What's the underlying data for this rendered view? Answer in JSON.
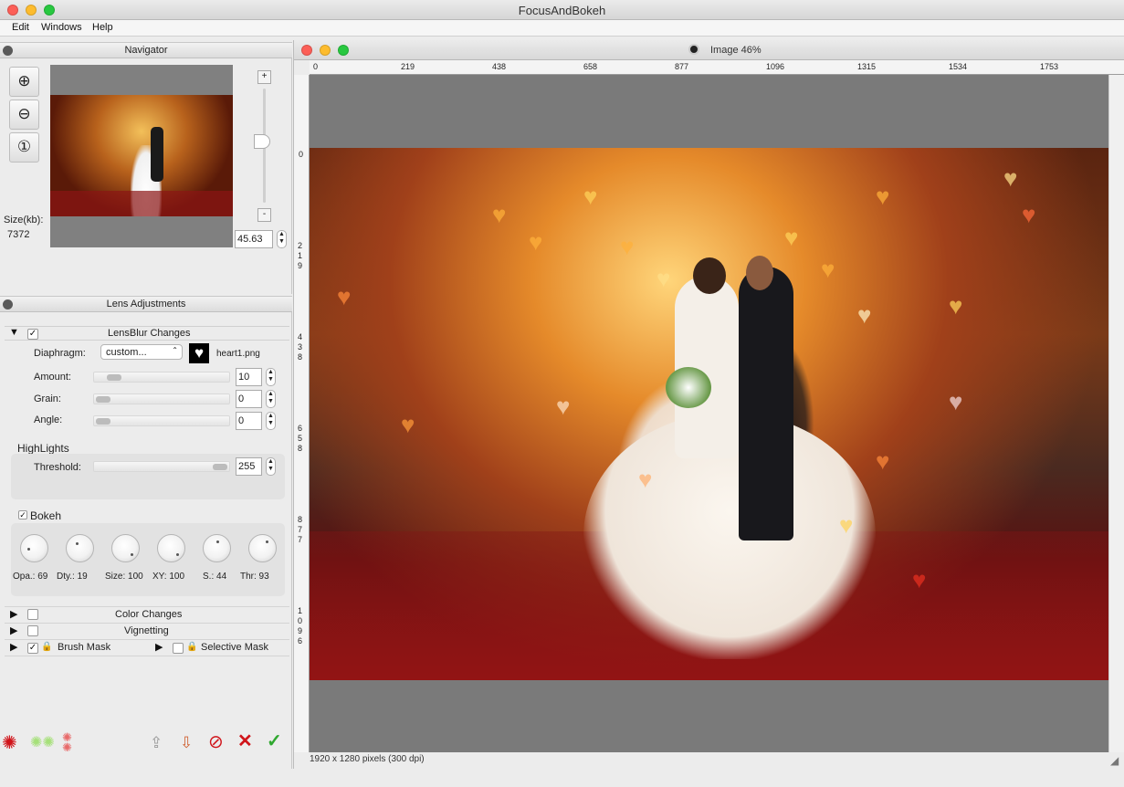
{
  "app": {
    "title": "FocusAndBokeh",
    "menus": [
      "Edit",
      "Windows",
      "Help"
    ]
  },
  "navigator": {
    "title": "Navigator",
    "size_label": "Size(kb):",
    "size_value": "7372",
    "zoom_value": "45.63",
    "zoom_in_icon": "zoom-in-icon",
    "zoom_out_icon": "zoom-out-icon",
    "zoom_actual_icon": "zoom-actual-icon"
  },
  "lens": {
    "title": "Lens Adjustments",
    "lensblur": {
      "label": "LensBlur Changes",
      "checked": true,
      "diaphragm_label": "Diaphragm:",
      "diaphragm_value": "custom...",
      "shape_file": "heart1.png",
      "amount_label": "Amount:",
      "amount_value": "10",
      "grain_label": "Grain:",
      "grain_value": "0",
      "angle_label": "Angle:",
      "angle_value": "0"
    },
    "highlights": {
      "label": "HighLights",
      "threshold_label": "Threshold:",
      "threshold_value": "255"
    },
    "bokeh": {
      "label": "Bokeh",
      "checked": true,
      "dials": [
        {
          "label": "Opa.: 69"
        },
        {
          "label": "Dty.: 19"
        },
        {
          "label": "Size: 100"
        },
        {
          "label": "XY: 100"
        },
        {
          "label": "S.: 44"
        },
        {
          "label": "Thr: 93"
        }
      ]
    },
    "sections": {
      "color_changes": "Color Changes",
      "vignetting": "Vignetting",
      "brush_mask": "Brush Mask",
      "selective_mask": "Selective Mask"
    }
  },
  "image_window": {
    "title": "Image 46%",
    "status": "1920 x 1280 pixels (300 dpi)",
    "ruler_h": [
      "0",
      "219",
      "438",
      "658",
      "877",
      "1096",
      "1315",
      "1534",
      "1753"
    ],
    "ruler_v_groups": [
      "0",
      "219",
      "438",
      "658",
      "877",
      "1096"
    ]
  },
  "colors": {
    "accent_red": "#d0141a",
    "accent_green": "#2fa82f",
    "bokeh_orange": "#ffb13b"
  }
}
